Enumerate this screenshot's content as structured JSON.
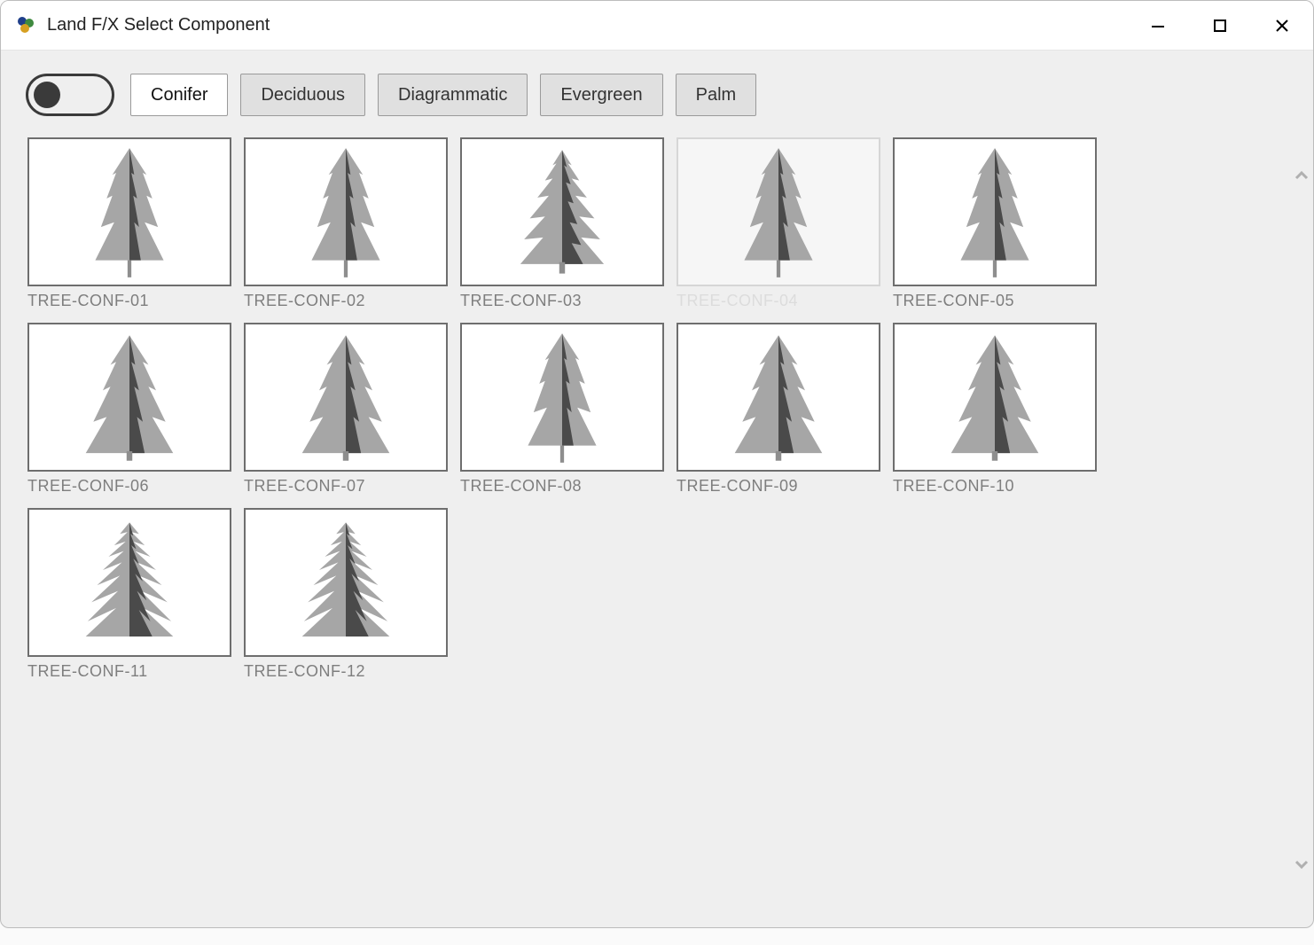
{
  "window": {
    "title": "Land F/X Select Component"
  },
  "toolbar": {
    "toggle_state": "off",
    "categories": [
      {
        "label": "Conifer",
        "active": true
      },
      {
        "label": "Deciduous",
        "active": false
      },
      {
        "label": "Diagrammatic",
        "active": false
      },
      {
        "label": "Evergreen",
        "active": false
      },
      {
        "label": "Palm",
        "active": false
      }
    ]
  },
  "grid": {
    "items": [
      {
        "label": "TREE-CONF-01",
        "dimmed": false
      },
      {
        "label": "TREE-CONF-02",
        "dimmed": false
      },
      {
        "label": "TREE-CONF-03",
        "dimmed": false
      },
      {
        "label": "TREE-CONF-04",
        "dimmed": true
      },
      {
        "label": "TREE-CONF-05",
        "dimmed": false
      },
      {
        "label": "TREE-CONF-06",
        "dimmed": false
      },
      {
        "label": "TREE-CONF-07",
        "dimmed": false
      },
      {
        "label": "TREE-CONF-08",
        "dimmed": false
      },
      {
        "label": "TREE-CONF-09",
        "dimmed": false
      },
      {
        "label": "TREE-CONF-10",
        "dimmed": false
      },
      {
        "label": "TREE-CONF-11",
        "dimmed": false
      },
      {
        "label": "TREE-CONF-12",
        "dimmed": false
      }
    ]
  },
  "icons": {
    "minimize": "minimize",
    "maximize": "maximize",
    "close": "close",
    "scroll_up": "chevron-up",
    "scroll_down": "chevron-down"
  }
}
